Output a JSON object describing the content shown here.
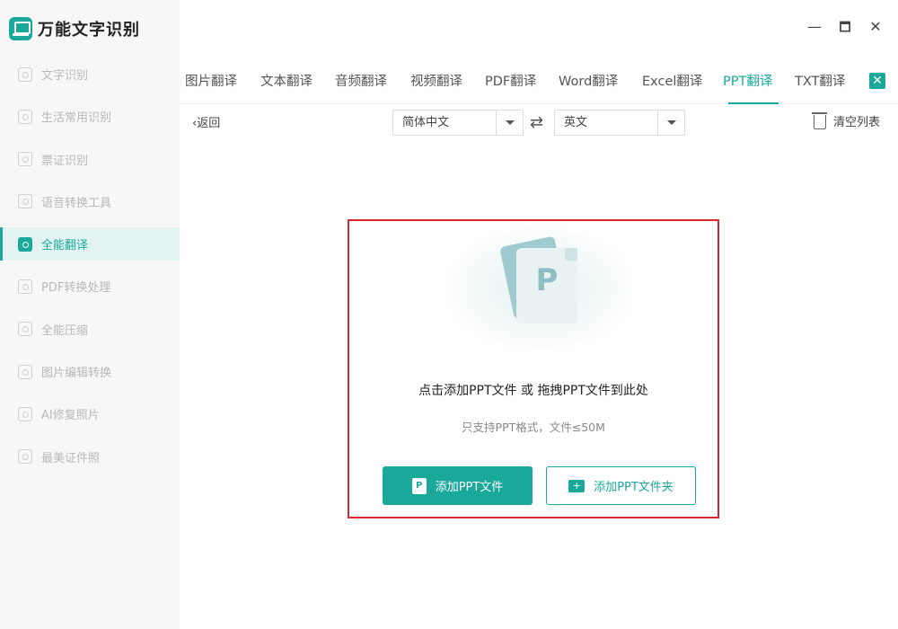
{
  "app": {
    "name": "万能文字识别"
  },
  "sidebar": {
    "items": [
      {
        "label": "文字识别"
      },
      {
        "label": "生活常用识别"
      },
      {
        "label": "票证识别"
      },
      {
        "label": "语音转换工具"
      },
      {
        "label": "全能翻译",
        "active": true
      },
      {
        "label": "PDF转换处理"
      },
      {
        "label": "全能压缩"
      },
      {
        "label": "图片编辑转换"
      },
      {
        "label": "AI修复照片"
      },
      {
        "label": "最美证件照"
      }
    ]
  },
  "window": {
    "minimize": "—",
    "maximize": "🗖",
    "close": "✕"
  },
  "tabs": {
    "items": [
      "图片翻译",
      "文本翻译",
      "音频翻译",
      "视频翻译",
      "PDF翻译",
      "Word翻译",
      "Excel翻译",
      "PPT翻译",
      "TXT翻译"
    ],
    "active_index": 7,
    "close_label": "✕"
  },
  "toolbar": {
    "back_label": "返回",
    "source_lang": "简体中文",
    "target_lang": "英文",
    "swap_icon": "⇄",
    "clear_label": "清空列表"
  },
  "dropzone": {
    "doc_letter": "P",
    "main_hint": "点击添加PPT文件 或 拖拽PPT文件到此处",
    "sub_hint": "只支持PPT格式，文件≤50M",
    "add_file_label": "添加PPT文件",
    "add_folder_label": "添加PPT文件夹",
    "file_icon_letter": "P",
    "folder_icon_glyph": "+"
  },
  "colors": {
    "accent": "#1aa89a",
    "highlight_border": "#d9282f"
  }
}
